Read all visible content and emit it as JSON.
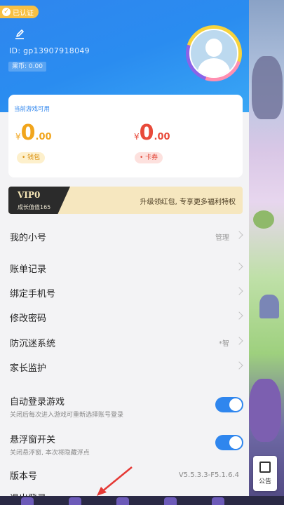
{
  "header": {
    "verified_badge": "已认证",
    "uid": "ID:  gp13907918049",
    "coin": "果币: 0.00",
    "edit_icon": "edit-icon",
    "avatar_icon": "user-avatar-icon"
  },
  "wallet": {
    "title": "当前游戏可用",
    "wallet_amount": {
      "currency": "¥",
      "int": "0",
      "dec": ".00"
    },
    "wallet_label": "• 钱包",
    "coupon_amount": {
      "currency": "¥",
      "int": "0",
      "dec": ".00"
    },
    "coupon_label": "• 卡券"
  },
  "vip": {
    "level": "VIP0",
    "growth": "成长值值165",
    "promo": "升级领红包, 专享更多福利特权"
  },
  "menu": [
    {
      "label": "我的小号",
      "right": "管理"
    },
    {
      "label": "账单记录",
      "right": ""
    },
    {
      "label": "绑定手机号",
      "right": ""
    },
    {
      "label": "修改密码",
      "right": ""
    },
    {
      "label": "防沉迷系统",
      "right": "*智"
    },
    {
      "label": "家长监护",
      "right": ""
    }
  ],
  "toggles": [
    {
      "label": "自动登录游戏",
      "sub": "关闭后每次进入游戏可重新选择账号登录",
      "on": true
    },
    {
      "label": "悬浮窗开关",
      "sub": "关闭悬浮窗, 本次将隐藏浮点",
      "on": true
    }
  ],
  "version": {
    "label": "版本号",
    "value": "V5.5.3.3-F5.1.6.4"
  },
  "cut_row": {
    "label": "退出登录"
  },
  "notice": {
    "label": "公告",
    "icon": "notice-icon"
  },
  "colors": {
    "accent": "#2f86ee",
    "yellow": "#f1a51c",
    "red": "#e84a3a"
  }
}
